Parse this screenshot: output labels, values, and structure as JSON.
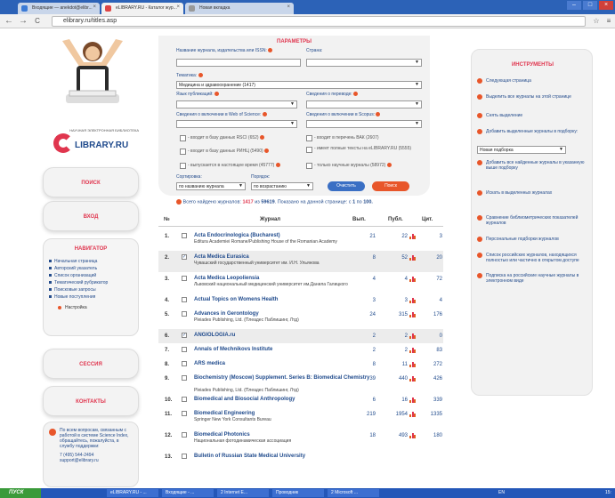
{
  "browser": {
    "tabs": [
      {
        "label": "Входящие — anekdot@elibr..."
      },
      {
        "label": "eLIBRARY.RU - Каталог жур..."
      },
      {
        "label": "Новая вкладка"
      }
    ],
    "url": "elibrary.ru/titles.asp"
  },
  "left": {
    "logo_small": "НАУЧНАЯ ЭЛЕКТРОННАЯ БИБЛИОТЕКА",
    "logo_main": "LIBRARY.RU",
    "search_btn": "ПОИСК",
    "login_btn": "ВХОД",
    "nav_title": "НАВИГАТОР",
    "nav_items": [
      "Начальная страница",
      "Авторский указатель",
      "Список организаций",
      "Тематический рубрикатор",
      "Поисковые запросы",
      "Новые поступления"
    ],
    "settings": "Настройка",
    "session_btn": "СЕССИЯ",
    "contacts_btn": "КОНТАКТЫ",
    "help_text": "По всем вопросам, связанным с работой в системе Science Index, обращайтесь, пожалуйста, в службу поддержки:",
    "phone": "7 (495) 544-2494",
    "email": "support@elibrary.ru"
  },
  "params": {
    "title": "ПАРАМЕТРЫ",
    "name_label": "Название журнала, издательства или ISSN:",
    "country_label": "Страна:",
    "topic_label": "Тематика:",
    "topic_value": "Медицина и здравоохранение  (1417)",
    "lang_label": "Язык публикаций:",
    "transl_label": "Сведения о переводе:",
    "wos_label": "Сведения о включении в Web of Science:",
    "scopus_label": "Сведения о включении в Scopus:",
    "cb1": "- входит в базу данных RSCI (652)",
    "cb2": "- входит в перечень ВАК (2607)",
    "cb3": "- входит в базу данных РИНЦ (5490)",
    "cb4": "- имеет полные тексты на eLIBRARY.RU (5555)",
    "cb5": "- выпускается в настоящее время (45777)",
    "cb6": "- только научные журналы (58972)",
    "sort_label": "Сортировка:",
    "sort_value": "по названию журнала",
    "order_label": "Порядок:",
    "order_value": "по возрастанию",
    "clear_btn": "Очистить",
    "search_btn": "Поиск"
  },
  "summary": {
    "prefix": "Всего найдено журналов:",
    "found": "1417",
    "of": "из",
    "total": "59619",
    "shown": "Показано на данной странице: с",
    "from": "1",
    "to_word": "по",
    "to": "100."
  },
  "table": {
    "headers": [
      "№",
      "Журнал",
      "Вып.",
      "Публ.",
      "Цит."
    ],
    "rows": [
      {
        "n": "1.",
        "title": "Acta Endocrinologica (Bucharest)",
        "pub": "Editura Academiei Romane/Publishing House of the Romanian Academy",
        "v": "21",
        "p": "22",
        "c": "3",
        "checked": false
      },
      {
        "n": "2.",
        "title": "Acta Medica Eurasica",
        "pub": "Чувашский государственный университет им. И.Н. Ульянова",
        "v": "8",
        "p": "52",
        "c": "20",
        "checked": true
      },
      {
        "n": "3.",
        "title": "Acta Medica Leopoliensia",
        "pub": "Львовский национальный медицинский университет им.Данила Галицкого",
        "v": "4",
        "p": "4",
        "c": "72",
        "checked": false
      },
      {
        "n": "4.",
        "title": "Actual Topics on Womens Health",
        "pub": "",
        "v": "3",
        "p": "3",
        "c": "4",
        "checked": false
      },
      {
        "n": "5.",
        "title": "Advances in Gerontology",
        "pub": "Pleiades Publishing, Ltd. (Плеадес Паблишинг, Лтд)",
        "v": "24",
        "p": "315",
        "c": "176",
        "checked": false
      },
      {
        "n": "6.",
        "title": "ANGIOLOGIA.ru",
        "pub": "",
        "v": "2",
        "p": "2",
        "c": "0",
        "checked": true
      },
      {
        "n": "7.",
        "title": "Annals of Mechnikovs Institute",
        "pub": "",
        "v": "2",
        "p": "2",
        "c": "83",
        "checked": false
      },
      {
        "n": "8.",
        "title": "ARS medica",
        "pub": "",
        "v": "8",
        "p": "11",
        "c": "272",
        "checked": false
      },
      {
        "n": "9.",
        "title": "Biochemistry (Moscow) Supplement. Series B: Biomedical Chemistry",
        "pub": "Pleiades Publishing, Ltd. (Плеадес Паблишинг, Лтд)",
        "v": "39",
        "p": "440",
        "c": "426",
        "checked": false
      },
      {
        "n": "10.",
        "title": "Biomedical and Biosocial Anthropology",
        "pub": "",
        "v": "6",
        "p": "16",
        "c": "339",
        "checked": false
      },
      {
        "n": "11.",
        "title": "Biomedical Engineering",
        "pub": "Springer New York Consultants Bureau",
        "v": "219",
        "p": "1954",
        "c": "1335",
        "checked": false
      },
      {
        "n": "12.",
        "title": "Biomedical Photonics",
        "pub": "Национальная фотодинамическая ассоциация",
        "v": "18",
        "p": "493",
        "c": "180",
        "checked": false
      },
      {
        "n": "13.",
        "title": "Bulletin of Russian State Medical University",
        "pub": "",
        "v": "",
        "p": "",
        "c": "",
        "checked": false
      }
    ]
  },
  "tools": {
    "title": "ИНСТРУМЕНТЫ",
    "next": "Следующая страница",
    "select_all": "Выделить все журналы на этой странице",
    "unselect": "Снять выделение",
    "add_selected": "Добавить выделенные журналы в подборку:",
    "collection_value": "Новая подборка",
    "add_all": "Добавить все найденные журналы в указанную выше подборку",
    "search_in": "Искать в выделенных журналах",
    "compare": "Сравнение библиометрических показателей журналов",
    "personal": "Персональные подборки журналов",
    "russian_list": "Список российских журналов, находящихся полностью или частично в открытом доступе",
    "subscribe": "Подписка на российские научные журналы в электронном виде"
  },
  "taskbar": {
    "start": "ПУСК",
    "items": [
      "eLIBRARY.RU - ...",
      "Входящие - ...",
      "2 Internet E...",
      "Проводник",
      "2 Microsoft ..."
    ],
    "lang": "EN",
    "time": "15:"
  }
}
